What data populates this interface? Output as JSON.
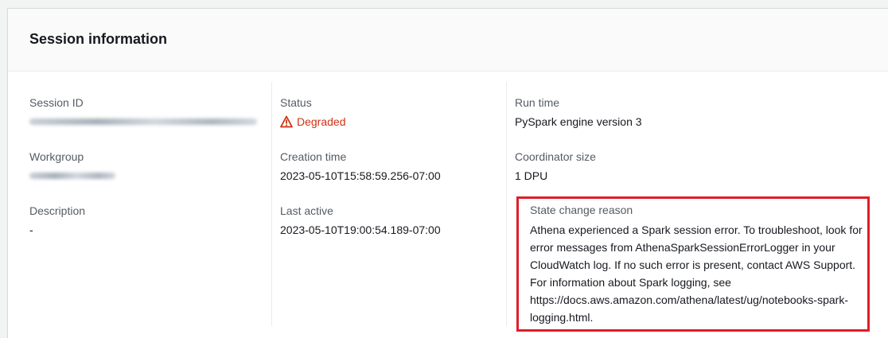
{
  "panel": {
    "title": "Session information"
  },
  "col1": {
    "session_id": {
      "label": "Session ID",
      "value": "1ac403f1-d21c-1f1d-7a4c-4202466b6765"
    },
    "workgroup": {
      "label": "Workgroup",
      "value": "hansen-demo"
    },
    "description": {
      "label": "Description",
      "value": "-"
    }
  },
  "col2": {
    "status": {
      "label": "Status",
      "value": "Degraded",
      "color": "#d13212"
    },
    "creation_time": {
      "label": "Creation time",
      "value": "2023-05-10T15:58:59.256-07:00"
    },
    "last_active": {
      "label": "Last active",
      "value": "2023-05-10T19:00:54.189-07:00"
    }
  },
  "col3": {
    "run_time": {
      "label": "Run time",
      "value": "PySpark engine version 3"
    },
    "coordinator_size": {
      "label": "Coordinator size",
      "value": "1 DPU"
    },
    "state_change_reason": {
      "label": "State change reason",
      "value": "Athena experienced a Spark session error. To troubleshoot, look for error messages from AthenaSparkSessionErrorLogger in your CloudWatch log. If no such error is present, contact AWS Support. For information about Spark logging, see https://docs.aws.amazon.com/athena/latest/ug/notebooks-spark-logging.html."
    }
  },
  "icons": {
    "status_icon": "warning-triangle-icon"
  },
  "colors": {
    "highlight_border": "#e01e2a",
    "status_degraded": "#d13212"
  }
}
